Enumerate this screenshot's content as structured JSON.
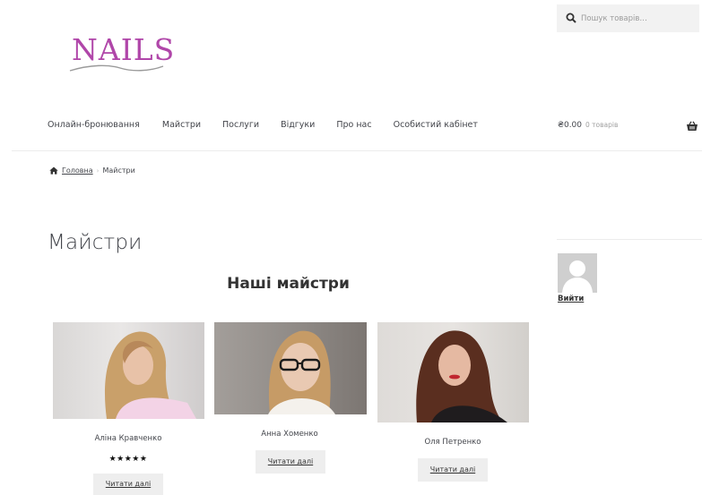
{
  "search": {
    "placeholder": "Пошук товарів…"
  },
  "logo": {
    "text": "NAILS"
  },
  "nav": {
    "items": [
      {
        "label": "Онлайн-бронювання"
      },
      {
        "label": "Майстри"
      },
      {
        "label": "Послуги"
      },
      {
        "label": "Відгуки"
      },
      {
        "label": "Про нас"
      },
      {
        "label": "Особистий кабінет"
      }
    ]
  },
  "cart": {
    "total": "₴0.00",
    "count": "0 товарів"
  },
  "breadcrumb": {
    "home": "Головна",
    "separator": "›",
    "current": "Майстри"
  },
  "page": {
    "title": "Майстри",
    "section_title": "Наші майстри"
  },
  "masters": [
    {
      "name": "Аліна Кравченко",
      "rating_stars": "★★★★★",
      "rating": 5,
      "button": "Читати далі"
    },
    {
      "name": "Анна Хоменко",
      "button": "Читати далі"
    },
    {
      "name": "Оля Петренко",
      "button": "Читати далі"
    }
  ],
  "sidebar": {
    "logout": "Вийти"
  },
  "colors": {
    "brand": "#b046a9",
    "text": "#43454b",
    "button_bg": "#eeeeee"
  },
  "icons": {
    "search": "search-icon",
    "cart": "basket-icon",
    "home": "home-icon",
    "avatar": "user-avatar-icon"
  }
}
